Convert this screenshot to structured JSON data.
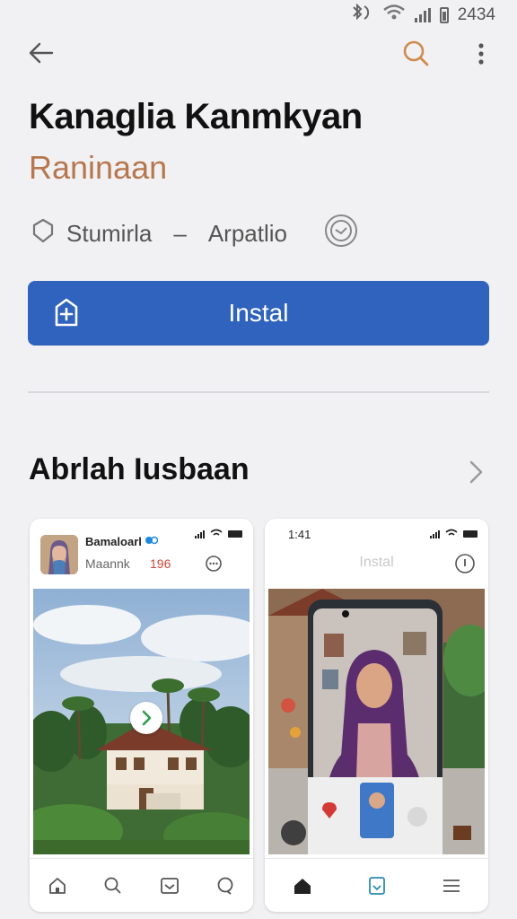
{
  "status_bar": {
    "time": "2434"
  },
  "app": {
    "title": "Kanaglia Kanmkyan",
    "developer": "Raninaan",
    "meta_left": "Stumirla",
    "meta_sep": "–",
    "meta_right": "Arpatlio",
    "install_label": "Instal",
    "accent_color": "#2f63bd",
    "developer_color": "#b7774e"
  },
  "section": {
    "title": "Abrlah Iusbaan"
  },
  "screenshots": [
    {
      "app_name": "Bamaloarl",
      "sub_label": "Maannk",
      "number": "196",
      "nav_icons": [
        "home-icon",
        "search-icon",
        "inbox-icon",
        "chat-icon"
      ]
    },
    {
      "time": "1:41",
      "install_label": "Instal",
      "nav_icons": [
        "home-icon",
        "bookmark-icon",
        "menu-icon"
      ]
    }
  ]
}
